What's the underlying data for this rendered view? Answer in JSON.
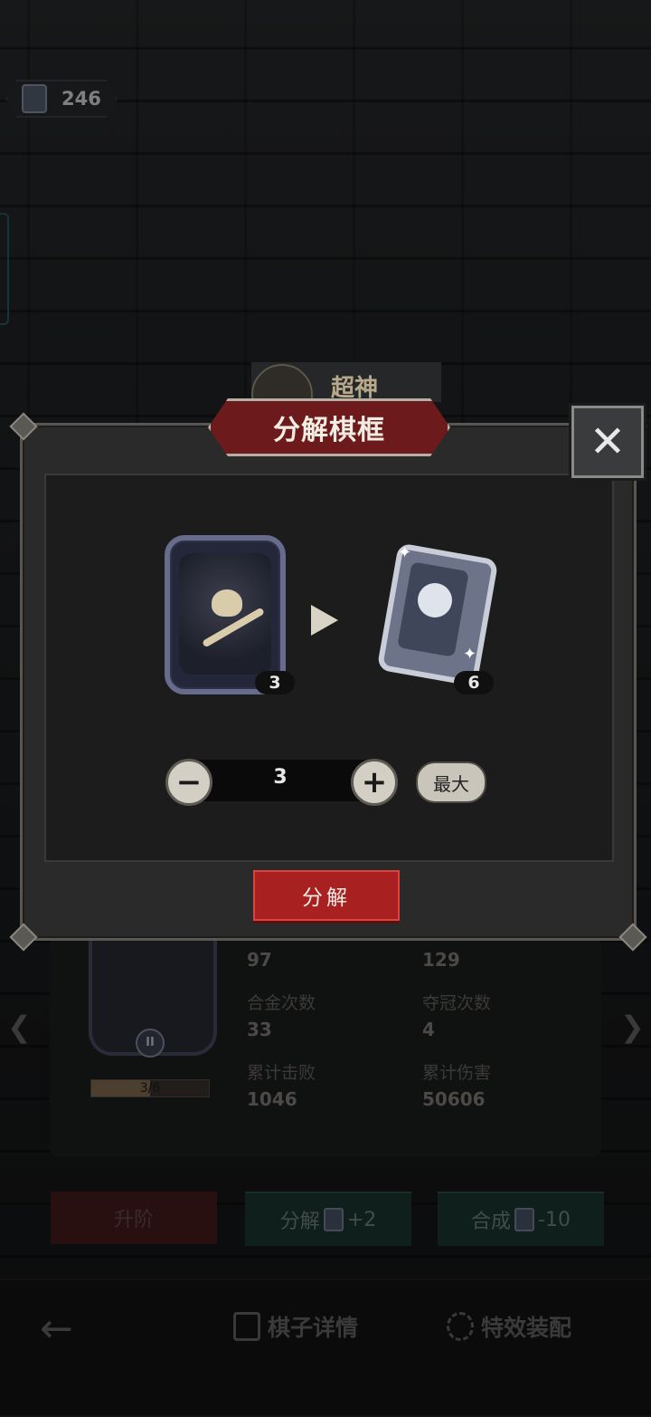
{
  "currency": {
    "icon": "card-fragment-icon",
    "amount": "246"
  },
  "title_behind": "超神",
  "modal": {
    "title": "分解棋框",
    "source_count": "3",
    "result_count": "6",
    "quantity": "3",
    "minus_label": "−",
    "plus_label": "+",
    "max_label": "最大",
    "confirm_label": "分解",
    "close_label": "✕"
  },
  "detail": {
    "level_badge": "II",
    "progress_text": "3/6",
    "progress_value": 0.5,
    "stats": [
      {
        "label": "",
        "value": "97"
      },
      {
        "label": "",
        "value": "129"
      },
      {
        "label": "合金次数",
        "value": "33"
      },
      {
        "label": "夺冠次数",
        "value": "4"
      },
      {
        "label": "累计击败",
        "value": "1046"
      },
      {
        "label": "累计伤害",
        "value": "50606"
      }
    ]
  },
  "actions": {
    "upgrade": "升阶",
    "decompose": "分解",
    "decompose_delta": "+2",
    "compose": "合成",
    "compose_delta": "-10"
  },
  "nav": {
    "back": "←",
    "piece_details": "棋子详情",
    "effects": "特效装配"
  },
  "colors": {
    "accent_red": "#a8201f",
    "panel": "#2a2a2a",
    "green_btn": "#1b3a34"
  }
}
